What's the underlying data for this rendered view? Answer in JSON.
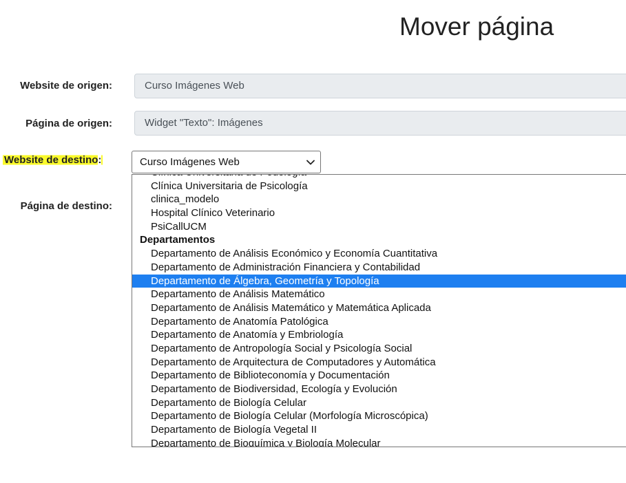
{
  "title": "Mover página",
  "form": {
    "origin_site_label": "Website de origen:",
    "origin_site_value": "Curso Imágenes Web",
    "origin_page_label": "Página de origen:",
    "origin_page_value": "Widget \"Texto\": Imágenes",
    "dest_site_label": "Website de destino",
    "dest_site_colon": ":",
    "dest_site_selected": "Curso Imágenes Web",
    "dest_page_label": "Página de destino:"
  },
  "dropdown": {
    "options": [
      {
        "text": "Clínica Universitaria de Podología",
        "type": "option"
      },
      {
        "text": "Clínica Universitaria de Psicología",
        "type": "option"
      },
      {
        "text": "clinica_modelo",
        "type": "option"
      },
      {
        "text": "Hospital Clínico Veterinario",
        "type": "option"
      },
      {
        "text": "PsiCallUCM",
        "type": "option"
      },
      {
        "text": "Departamentos",
        "type": "group"
      },
      {
        "text": "Departamento de Análisis Económico y Economía Cuantitativa",
        "type": "option"
      },
      {
        "text": "Departamento de Administración Financiera y Contabilidad",
        "type": "option"
      },
      {
        "text": "Departamento de Álgebra, Geometría y Topología",
        "type": "option",
        "selected": true
      },
      {
        "text": "Departamento de Análisis Matemático",
        "type": "option"
      },
      {
        "text": "Departamento de Análisis Matemático y Matemática Aplicada",
        "type": "option"
      },
      {
        "text": "Departamento de Anatomía Patológica",
        "type": "option"
      },
      {
        "text": "Departamento de Anatomía y Embriología",
        "type": "option"
      },
      {
        "text": "Departamento de Antropología Social y Psicología Social",
        "type": "option"
      },
      {
        "text": "Departamento de Arquitectura de Computadores y Automática",
        "type": "option"
      },
      {
        "text": "Departamento de Biblioteconomía y Documentación",
        "type": "option"
      },
      {
        "text": "Departamento de Biodiversidad, Ecología y Evolución",
        "type": "option"
      },
      {
        "text": "Departamento de Biología Celular",
        "type": "option"
      },
      {
        "text": "Departamento de Biología Celular (Morfología Microscópica)",
        "type": "option"
      },
      {
        "text": "Departamento de Biología Vegetal II",
        "type": "option"
      },
      {
        "text": "Departamento de Bioquímica y Biología Molecular",
        "type": "option"
      }
    ]
  },
  "colors": {
    "highlight": "#fafa2a",
    "selected_option": "#1e7ff0",
    "readonly_bg": "#e9ecef"
  },
  "icons": {
    "select_arrow": "chevron-down-icon"
  }
}
